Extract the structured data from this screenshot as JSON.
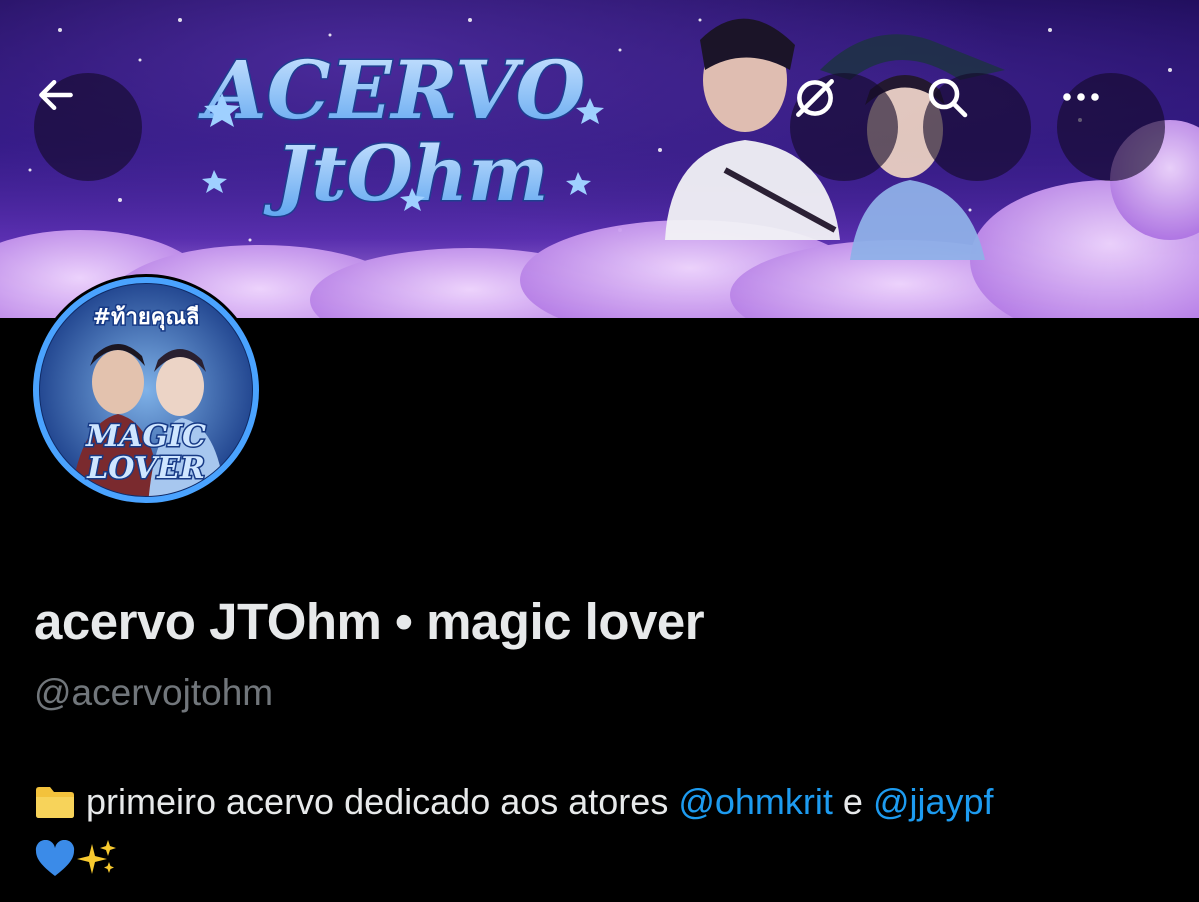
{
  "header": {
    "banner_title_line1": "ACERVO",
    "banner_title_line2": "JtOhm",
    "back_icon": "arrow-left-icon",
    "icons": [
      "arrow-left-icon",
      "grok-icon",
      "search-icon",
      "more-icon"
    ]
  },
  "avatar": {
    "hashtag": "#ท้ายคุณลี",
    "line1": "MAGIC",
    "line2": "LOVER"
  },
  "profile": {
    "display_name": "acervo JTOhm • magic lover",
    "handle": "@acervojtohm",
    "bio": {
      "prefix_emoji": "folder-icon",
      "text1": " primeiro acervo dedicado aos atores ",
      "mention1": "@ohmkrit",
      "text2": " e ",
      "mention2": "@jjaypf",
      "suffix_emojis": [
        "blue-heart-icon",
        "sparkles-icon"
      ]
    }
  },
  "colors": {
    "background": "#000000",
    "text_primary": "#e7e9ea",
    "text_secondary": "#71767b",
    "link": "#1d9bf0",
    "banner_title": "#8fc6ff"
  }
}
